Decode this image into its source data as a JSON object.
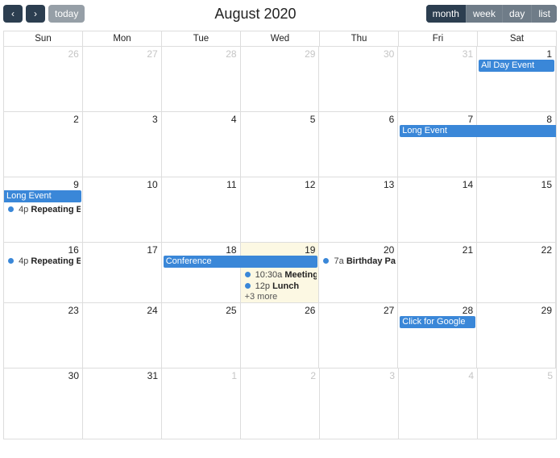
{
  "toolbar": {
    "prev": "‹",
    "next": "›",
    "today": "today",
    "title": "August 2020",
    "views": {
      "month": "month",
      "week": "week",
      "day": "day",
      "list": "list"
    },
    "active_view": "month"
  },
  "day_headers": [
    "Sun",
    "Mon",
    "Tue",
    "Wed",
    "Thu",
    "Fri",
    "Sat"
  ],
  "weeks": [
    {
      "days": [
        {
          "n": "26",
          "other": true
        },
        {
          "n": "27",
          "other": true
        },
        {
          "n": "28",
          "other": true
        },
        {
          "n": "29",
          "other": true
        },
        {
          "n": "30",
          "other": true
        },
        {
          "n": "31",
          "other": true
        },
        {
          "n": "1"
        }
      ]
    },
    {
      "days": [
        {
          "n": "2"
        },
        {
          "n": "3"
        },
        {
          "n": "4"
        },
        {
          "n": "5"
        },
        {
          "n": "6"
        },
        {
          "n": "7"
        },
        {
          "n": "8"
        }
      ]
    },
    {
      "days": [
        {
          "n": "9"
        },
        {
          "n": "10"
        },
        {
          "n": "11"
        },
        {
          "n": "12"
        },
        {
          "n": "13"
        },
        {
          "n": "14"
        },
        {
          "n": "15"
        }
      ]
    },
    {
      "days": [
        {
          "n": "16"
        },
        {
          "n": "17"
        },
        {
          "n": "18"
        },
        {
          "n": "19",
          "today": true
        },
        {
          "n": "20"
        },
        {
          "n": "21"
        },
        {
          "n": "22"
        }
      ]
    },
    {
      "days": [
        {
          "n": "23"
        },
        {
          "n": "24"
        },
        {
          "n": "25"
        },
        {
          "n": "26"
        },
        {
          "n": "27"
        },
        {
          "n": "28"
        },
        {
          "n": "29"
        }
      ]
    },
    {
      "days": [
        {
          "n": "30"
        },
        {
          "n": "31"
        },
        {
          "n": "1",
          "other": true
        },
        {
          "n": "2",
          "other": true
        },
        {
          "n": "3",
          "other": true
        },
        {
          "n": "4",
          "other": true
        },
        {
          "n": "5",
          "other": true
        }
      ]
    }
  ],
  "events": {
    "all_day_event": "All Day Event",
    "long_event": "Long Event",
    "repeating_event_time": "4p",
    "repeating_event_title": "Repeating Event",
    "conference": "Conference",
    "meeting_time": "10:30a",
    "meeting_title": "Meeting",
    "lunch_time": "12p",
    "lunch_title": "Lunch",
    "more": "+3 more",
    "birthday_time": "7a",
    "birthday_title": "Birthday Party",
    "google": "Click for Google"
  }
}
